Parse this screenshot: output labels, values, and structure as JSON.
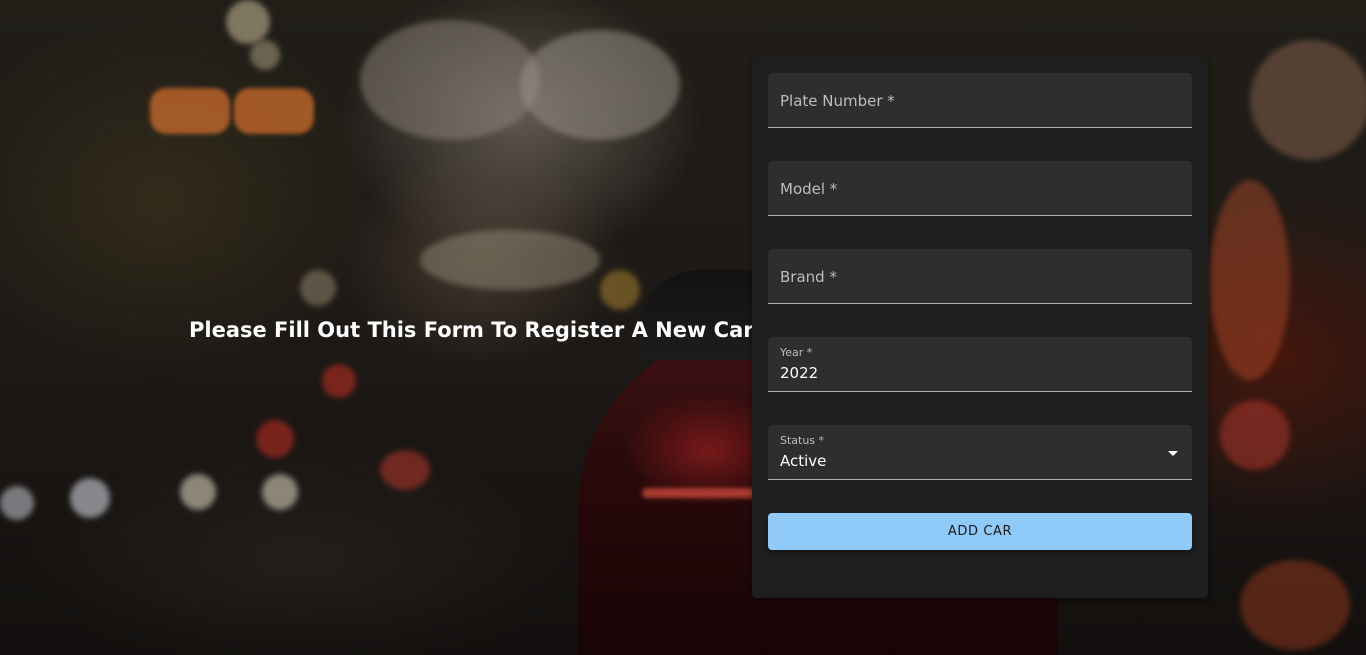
{
  "page": {
    "headline": "Please Fill Out This Form To Register A New Car"
  },
  "form": {
    "fields": [
      {
        "label": "Plate Number *",
        "value": ""
      },
      {
        "label": "Model *",
        "value": ""
      },
      {
        "label": "Brand *",
        "value": ""
      },
      {
        "label": "Year *",
        "value": "2022"
      },
      {
        "label": "Status *",
        "value": "Active"
      }
    ],
    "submit_label": "ADD CAR"
  },
  "colors": {
    "card_background": "#1e1e1e",
    "field_background": "#2e2e2e",
    "button_background": "#90caf9"
  },
  "icons": {
    "status_dropdown": "caret-down-icon"
  }
}
